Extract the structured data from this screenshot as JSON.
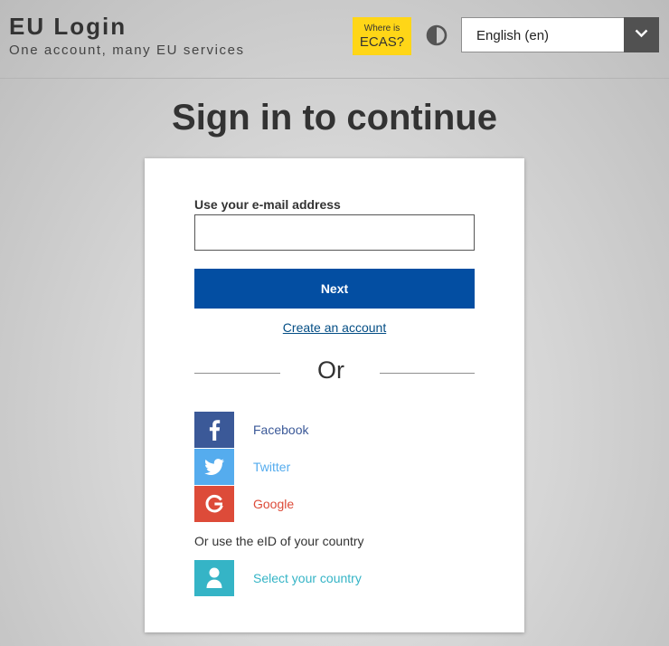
{
  "header": {
    "title": "EU Login",
    "subtitle": "One account, many EU services",
    "ecas_line1": "Where is",
    "ecas_line2": "ECAS?",
    "contrast_icon": "contrast-icon",
    "language": "English (en)"
  },
  "main": {
    "title": "Sign in to continue",
    "email_label": "Use your e-mail address",
    "email_value": "",
    "next_label": "Next",
    "create_account": "Create an account",
    "or_text": "Or",
    "social": [
      {
        "label": "Facebook",
        "icon": "facebook-icon",
        "color": "#3b5998"
      },
      {
        "label": "Twitter",
        "icon": "twitter-icon",
        "color": "#55acee"
      },
      {
        "label": "Google",
        "icon": "google-icon",
        "color": "#dd4b39"
      }
    ],
    "eid_text": "Or use the eID of your country",
    "country_label": "Select your country",
    "country_icon": "person-icon",
    "country_color": "#35b4c6"
  },
  "colors": {
    "primary": "#034ea2",
    "ecas_yellow": "#ffd617",
    "link": "#044e85"
  }
}
